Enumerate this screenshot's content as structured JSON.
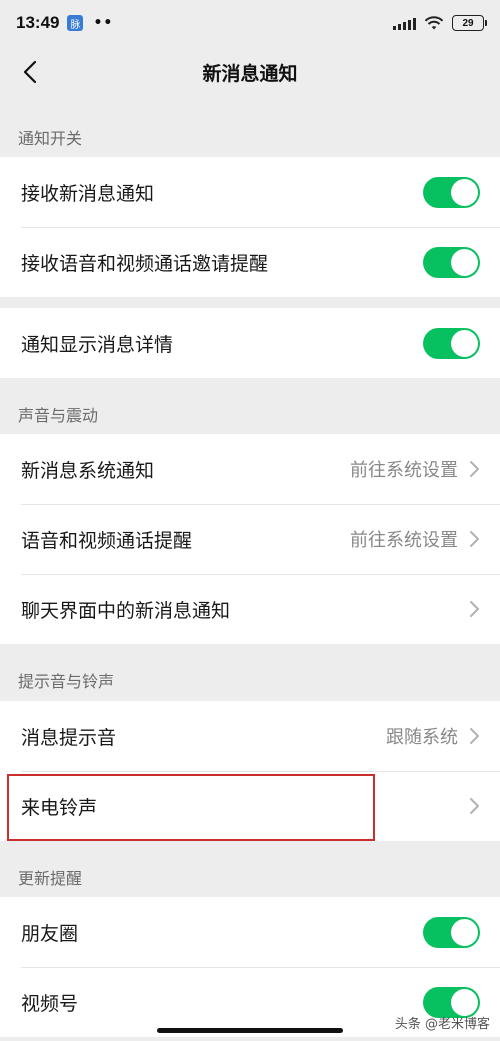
{
  "status_bar": {
    "time": "13:49",
    "badge": "脉",
    "dots": "••",
    "battery": "29",
    "icons": [
      "signal-icon",
      "wifi-icon",
      "battery-icon"
    ]
  },
  "nav": {
    "title": "新消息通知",
    "back_icon": "chevron-left-icon"
  },
  "sections": {
    "notify_switch": {
      "header": "通知开关",
      "receive_new": "接收新消息通知",
      "receive_call_invite": "接收语音和视频通话邀请提醒",
      "show_details": "通知显示消息详情"
    },
    "sound_vibration": {
      "header": "声音与震动",
      "new_msg_system": "新消息系统通知",
      "new_msg_system_value": "前往系统设置",
      "call_reminder": "语音和视频通话提醒",
      "call_reminder_value": "前往系统设置",
      "chat_new_msg": "聊天界面中的新消息通知"
    },
    "tone_ringtone": {
      "header": "提示音与铃声",
      "msg_tone": "消息提示音",
      "msg_tone_value": "跟随系统",
      "ringtone": "来电铃声"
    },
    "update_reminder": {
      "header": "更新提醒",
      "moments": "朋友圈",
      "channels": "视频号"
    }
  },
  "toggles": {
    "receive_new": true,
    "receive_call_invite": true,
    "show_details": true,
    "moments": true,
    "channels": true
  },
  "colors": {
    "toggle_on": "#07c160",
    "highlight": "#c9302c",
    "background": "#ededed"
  },
  "watermark": "头条 @老米博客"
}
